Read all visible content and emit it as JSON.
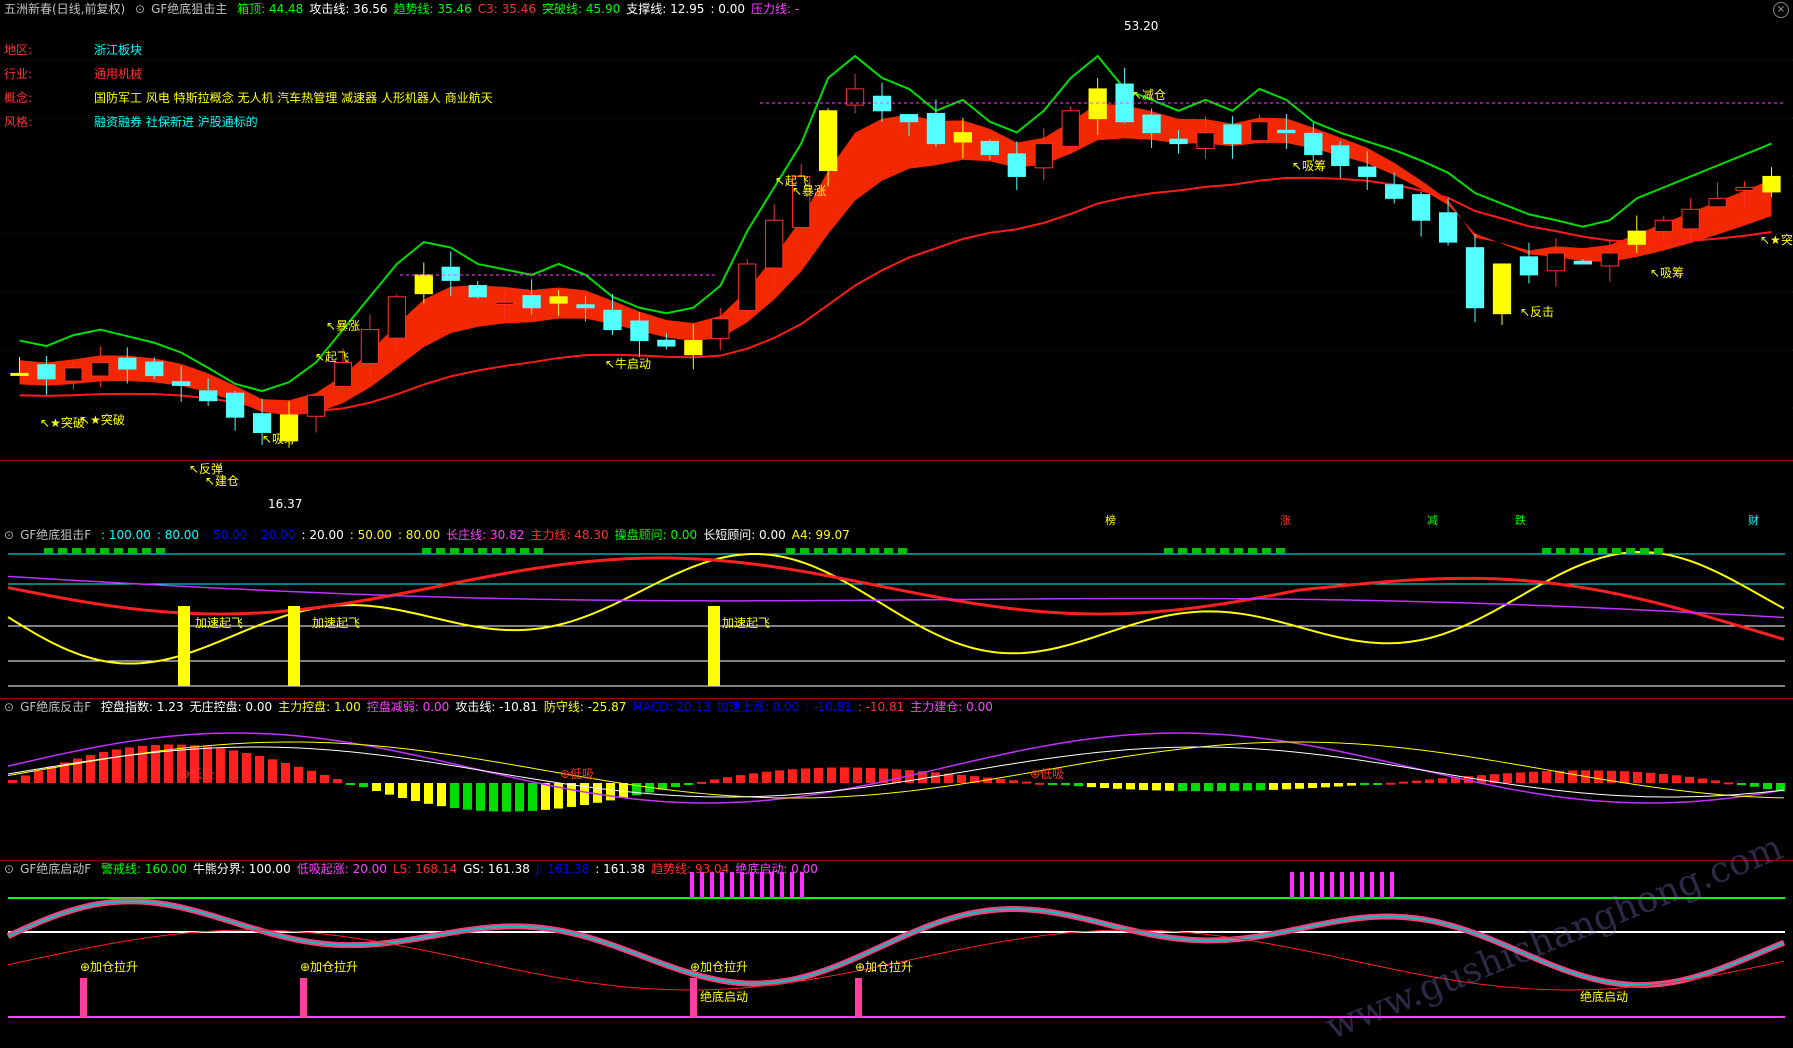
{
  "main": {
    "stock": "五洲新春(日线,前复权)",
    "indicator": "GF绝底狙击主",
    "params": [
      {
        "label": "箱顶: 44.48",
        "color": "#00ff00"
      },
      {
        "label": "攻击线: 36.56",
        "color": "#ffffff"
      },
      {
        "label": "趋势线: 35.46",
        "color": "#00ff00"
      },
      {
        "label": "C3: 35.46",
        "color": "#ff3030"
      },
      {
        "label": "突破线: 45.90",
        "color": "#00ff00"
      },
      {
        "label": "支撑线: 12.95",
        "color": "#ffffff"
      },
      {
        "label": ": 0.00",
        "color": "#ffffff"
      },
      {
        "label": "压力线: -",
        "color": "#ff40ff"
      }
    ],
    "info": [
      {
        "key": "地区:",
        "val": "浙江板块",
        "color": "#00ffff"
      },
      {
        "key": "行业:",
        "val": "通用机械",
        "color": "#ff3030"
      },
      {
        "key": "概念:",
        "val": "国防军工 风电 特斯拉概念 无人机 汽车热管理 减速器 人形机器人 商业航天",
        "color": "#ffff00"
      },
      {
        "key": "风格:",
        "val": "融资融券 社保新进 沪股通标的",
        "color": "#00ffff"
      }
    ],
    "high_label": "53.20",
    "low_label": "16.37",
    "signals": [
      {
        "text": "★突破",
        "color": "#ffff00"
      },
      {
        "text": "★突破",
        "color": "#ffff00"
      },
      {
        "text": "吸筹",
        "color": "#ffff00"
      },
      {
        "text": "起飞",
        "color": "#ffff00"
      },
      {
        "text": "暴涨",
        "color": "#ffff00"
      },
      {
        "text": "牛启动",
        "color": "#ffff00"
      },
      {
        "text": "起飞",
        "color": "#ffff00"
      },
      {
        "text": "暴涨",
        "color": "#ffff00"
      },
      {
        "text": "减仓",
        "color": "#ffff00"
      },
      {
        "text": "吸筹",
        "color": "#ffff00"
      },
      {
        "text": "反击",
        "color": "#ffff00"
      },
      {
        "text": "吸筹",
        "color": "#ffff00"
      },
      {
        "text": "★突破",
        "color": "#ffff00"
      },
      {
        "text": "建仓",
        "color": "#ffff00"
      },
      {
        "text": "反弹",
        "color": "#ffff00"
      }
    ],
    "tags": [
      {
        "text": "榜",
        "color": "#ffff00"
      },
      {
        "text": "涨",
        "color": "#ff3030"
      },
      {
        "text": "减",
        "color": "#00ff00"
      },
      {
        "text": "跌",
        "color": "#00ff00"
      },
      {
        "text": "财",
        "color": "#00ffff"
      }
    ]
  },
  "p2": {
    "indicator": "GF绝底狙击F",
    "params": [
      {
        "label": ": 100.00",
        "color": "#00ffff"
      },
      {
        "label": ": 80.00",
        "color": "#00ffff"
      },
      {
        "label": ": 50.00",
        "color": "#0000ff"
      },
      {
        "label": ": 20.00",
        "color": "#0000ff"
      },
      {
        "label": ": 20.00",
        "color": "#ffffff"
      },
      {
        "label": ": 50.00",
        "color": "#ffff00"
      },
      {
        "label": ": 80.00",
        "color": "#ffff00"
      },
      {
        "label": "长庄线: 30.82",
        "color": "#ff40ff"
      },
      {
        "label": "主力线: 48.30",
        "color": "#ff3030"
      },
      {
        "label": "操盘顾问: 0.00",
        "color": "#00ff00"
      },
      {
        "label": "长短顾问: 0.00",
        "color": "#ffffff"
      },
      {
        "label": "A4: 99.07",
        "color": "#ffff00"
      }
    ],
    "signal": "加速起飞"
  },
  "p3": {
    "indicator": "GF绝底反击F",
    "params": [
      {
        "label": "控盘指数: 1.23",
        "color": "#ffffff"
      },
      {
        "label": "无庄控盘: 0.00",
        "color": "#ffffff"
      },
      {
        "label": "主力控盘: 1.00",
        "color": "#ffff00"
      },
      {
        "label": "控盘减弱: 0.00",
        "color": "#ff40ff"
      },
      {
        "label": "攻击线: -10.81",
        "color": "#ffffff"
      },
      {
        "label": "防守线: -25.87",
        "color": "#ffff00"
      },
      {
        "label": "MACD: 20.13",
        "color": "#0000ff"
      },
      {
        "label": "加速上涨: 0.00",
        "color": "#0000ff"
      },
      {
        "label": ": -10.81",
        "color": "#0000ff"
      },
      {
        "label": ": -10.81",
        "color": "#ff3030"
      },
      {
        "label": "主力建仓: 0.00",
        "color": "#ff40ff"
      }
    ],
    "signal": "低吸"
  },
  "p4": {
    "indicator": "GF绝底启动F",
    "params": [
      {
        "label": "警戒线: 160.00",
        "color": "#00ff00"
      },
      {
        "label": "牛熊分界: 100.00",
        "color": "#ffffff"
      },
      {
        "label": "低吸起涨: 20.00",
        "color": "#ff40ff"
      },
      {
        "label": "LS: 168.14",
        "color": "#ff3030"
      },
      {
        "label": "GS: 161.38",
        "color": "#ffffff"
      },
      {
        "label": "J: 161.38",
        "color": "#0000ff"
      },
      {
        "label": ": 161.38",
        "color": "#ffffff"
      },
      {
        "label": "趋势线: 93.04",
        "color": "#ff3030"
      },
      {
        "label": "绝底启动: 0.00",
        "color": "#ff40ff"
      }
    ],
    "signal": "加仓拉升",
    "signal2": "绝底启动"
  },
  "watermark": "www.gushichanghong.com",
  "chart_data": {
    "type": "line",
    "title": "GF绝底狙击主",
    "x_count": 58,
    "close": [
      22,
      21.5,
      22.5,
      23,
      22.4,
      21.8,
      20.9,
      19.5,
      18,
      16.6,
      18.2,
      20,
      23,
      26,
      29,
      31,
      30.5,
      29,
      28.5,
      28,
      29,
      28,
      26,
      25,
      24.5,
      25,
      27,
      32,
      36,
      40,
      46,
      48,
      46,
      45,
      43,
      44,
      42,
      40,
      43,
      46,
      48,
      45,
      44,
      43,
      44,
      43,
      45,
      44,
      42,
      41,
      40,
      38,
      36,
      34,
      28,
      32,
      31,
      33,
      32,
      33,
      35,
      36,
      37,
      38,
      39,
      40
    ],
    "attack_line": 36.56,
    "trend_line": 35.46,
    "box_top": 44.48,
    "breakout_line": 45.9,
    "support_line": 12.95,
    "y_range": [
      16.37,
      53.2
    ]
  }
}
